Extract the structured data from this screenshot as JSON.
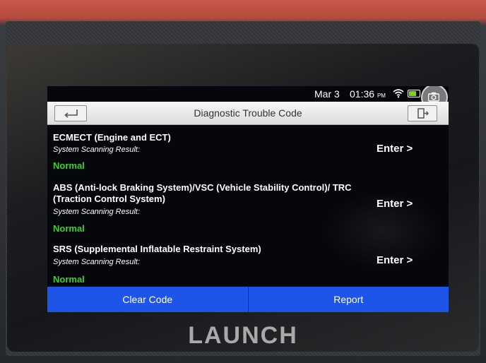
{
  "status": {
    "date": "Mar 3",
    "time": "01:36",
    "ampm": "PM"
  },
  "header": {
    "title": "Diagnostic Trouble Code",
    "back_icon": "back-arrow-icon",
    "exit_icon": "exit-door-icon"
  },
  "systems": [
    {
      "name": "ECMECT (Engine and ECT)",
      "label": "System Scanning Result:",
      "status": "Normal",
      "action": "Enter >"
    },
    {
      "name": "ABS (Anti-lock Braking System)/VSC (Vehicle Stability Control)/ TRC (Traction Control System)",
      "label": "System Scanning Result:",
      "status": "Normal",
      "action": "Enter >"
    },
    {
      "name": "SRS (Supplemental Inflatable Restraint System)",
      "label": "System Scanning Result:",
      "status": "Normal",
      "action": "Enter >"
    }
  ],
  "footer": {
    "clear_label": "Clear Code",
    "report_label": "Report"
  },
  "device": {
    "brand": "LAUNCH"
  },
  "colors": {
    "status_ok": "#39d428",
    "button_blue": "#1d55e8"
  }
}
